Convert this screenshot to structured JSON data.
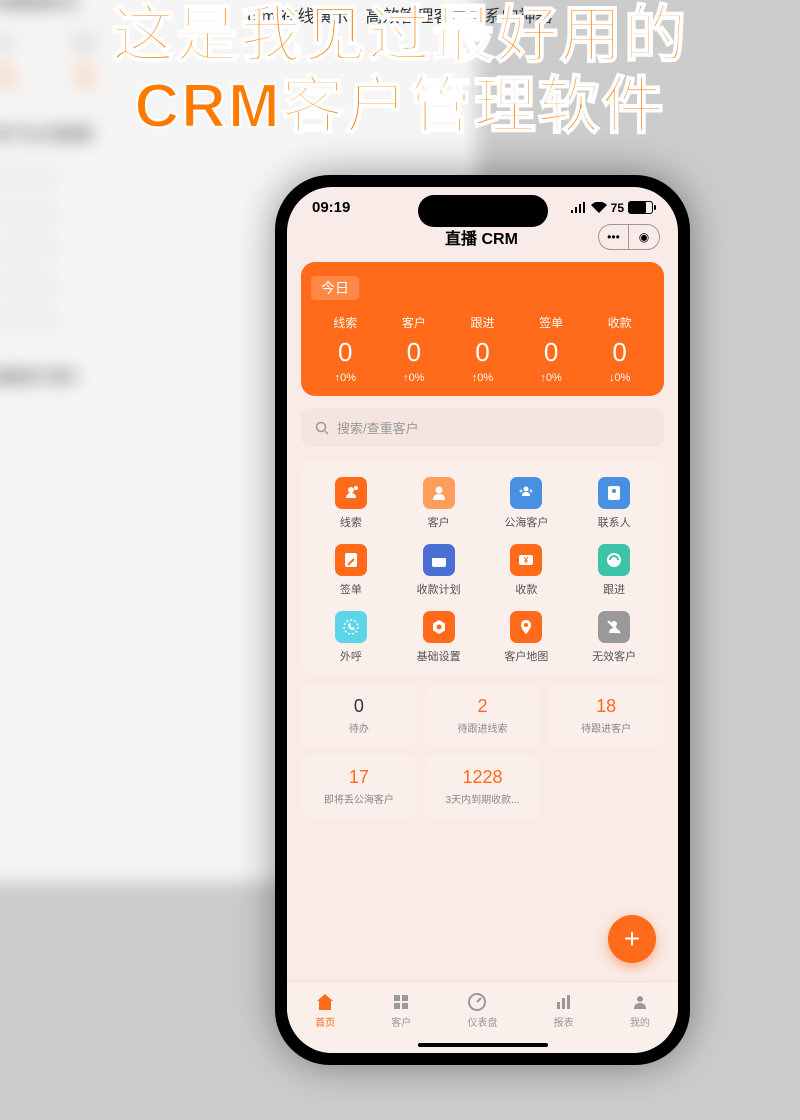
{
  "caption": "crm 在线演示，高效管理客户关系的神器",
  "headline_l1": "这是我见过最好用的",
  "headline_l2": "CRM客户管理软件",
  "bg": {
    "section1": "新增数据对比",
    "stats": [
      {
        "label": "客户",
        "val": "0",
        "pct": "+0%"
      },
      {
        "label": "跟进",
        "val": "0",
        "pct": "+0%"
      }
    ],
    "section2": "客户及公海指数",
    "section3": "最新客户推行"
  },
  "statusbar": {
    "time": "09:19",
    "battery": "75"
  },
  "app_title": "直播 CRM",
  "today": {
    "label": "今日",
    "stats": [
      {
        "name": "线索",
        "val": "0",
        "trend": "↑0%"
      },
      {
        "name": "客户",
        "val": "0",
        "trend": "↑0%"
      },
      {
        "name": "跟进",
        "val": "0",
        "trend": "↑0%"
      },
      {
        "name": "签单",
        "val": "0",
        "trend": "↑0%"
      },
      {
        "name": "收款",
        "val": "0",
        "trend": "↓0%"
      }
    ]
  },
  "search_placeholder": "搜索/查重客户",
  "menu": [
    {
      "label": "线索",
      "cls": "ic-lead"
    },
    {
      "label": "客户",
      "cls": "ic-cust"
    },
    {
      "label": "公海客户",
      "cls": "ic-pub"
    },
    {
      "label": "联系人",
      "cls": "ic-contact"
    },
    {
      "label": "签单",
      "cls": "ic-sign"
    },
    {
      "label": "收款计划",
      "cls": "ic-plan"
    },
    {
      "label": "收款",
      "cls": "ic-pay"
    },
    {
      "label": "跟进",
      "cls": "ic-follow"
    },
    {
      "label": "外呼",
      "cls": "ic-call"
    },
    {
      "label": "基础设置",
      "cls": "ic-setting"
    },
    {
      "label": "客户地图",
      "cls": "ic-map"
    },
    {
      "label": "无效客户",
      "cls": "ic-invalid"
    }
  ],
  "cards": [
    {
      "val": "0",
      "label": "待办",
      "color": "#333"
    },
    {
      "val": "2",
      "label": "待跟进线索",
      "color": "#ff6b1a"
    },
    {
      "val": "18",
      "label": "待跟进客户",
      "color": "#ff6b1a"
    },
    {
      "val": "17",
      "label": "即将丢公海客户",
      "color": "#ff6b1a"
    },
    {
      "val": "1228",
      "label": "3天内到期收款...",
      "color": "#ff6b1a"
    }
  ],
  "tabs": [
    {
      "label": "首页",
      "active": true
    },
    {
      "label": "客户",
      "active": false
    },
    {
      "label": "仪表盘",
      "active": false
    },
    {
      "label": "报表",
      "active": false
    },
    {
      "label": "我的",
      "active": false
    }
  ]
}
